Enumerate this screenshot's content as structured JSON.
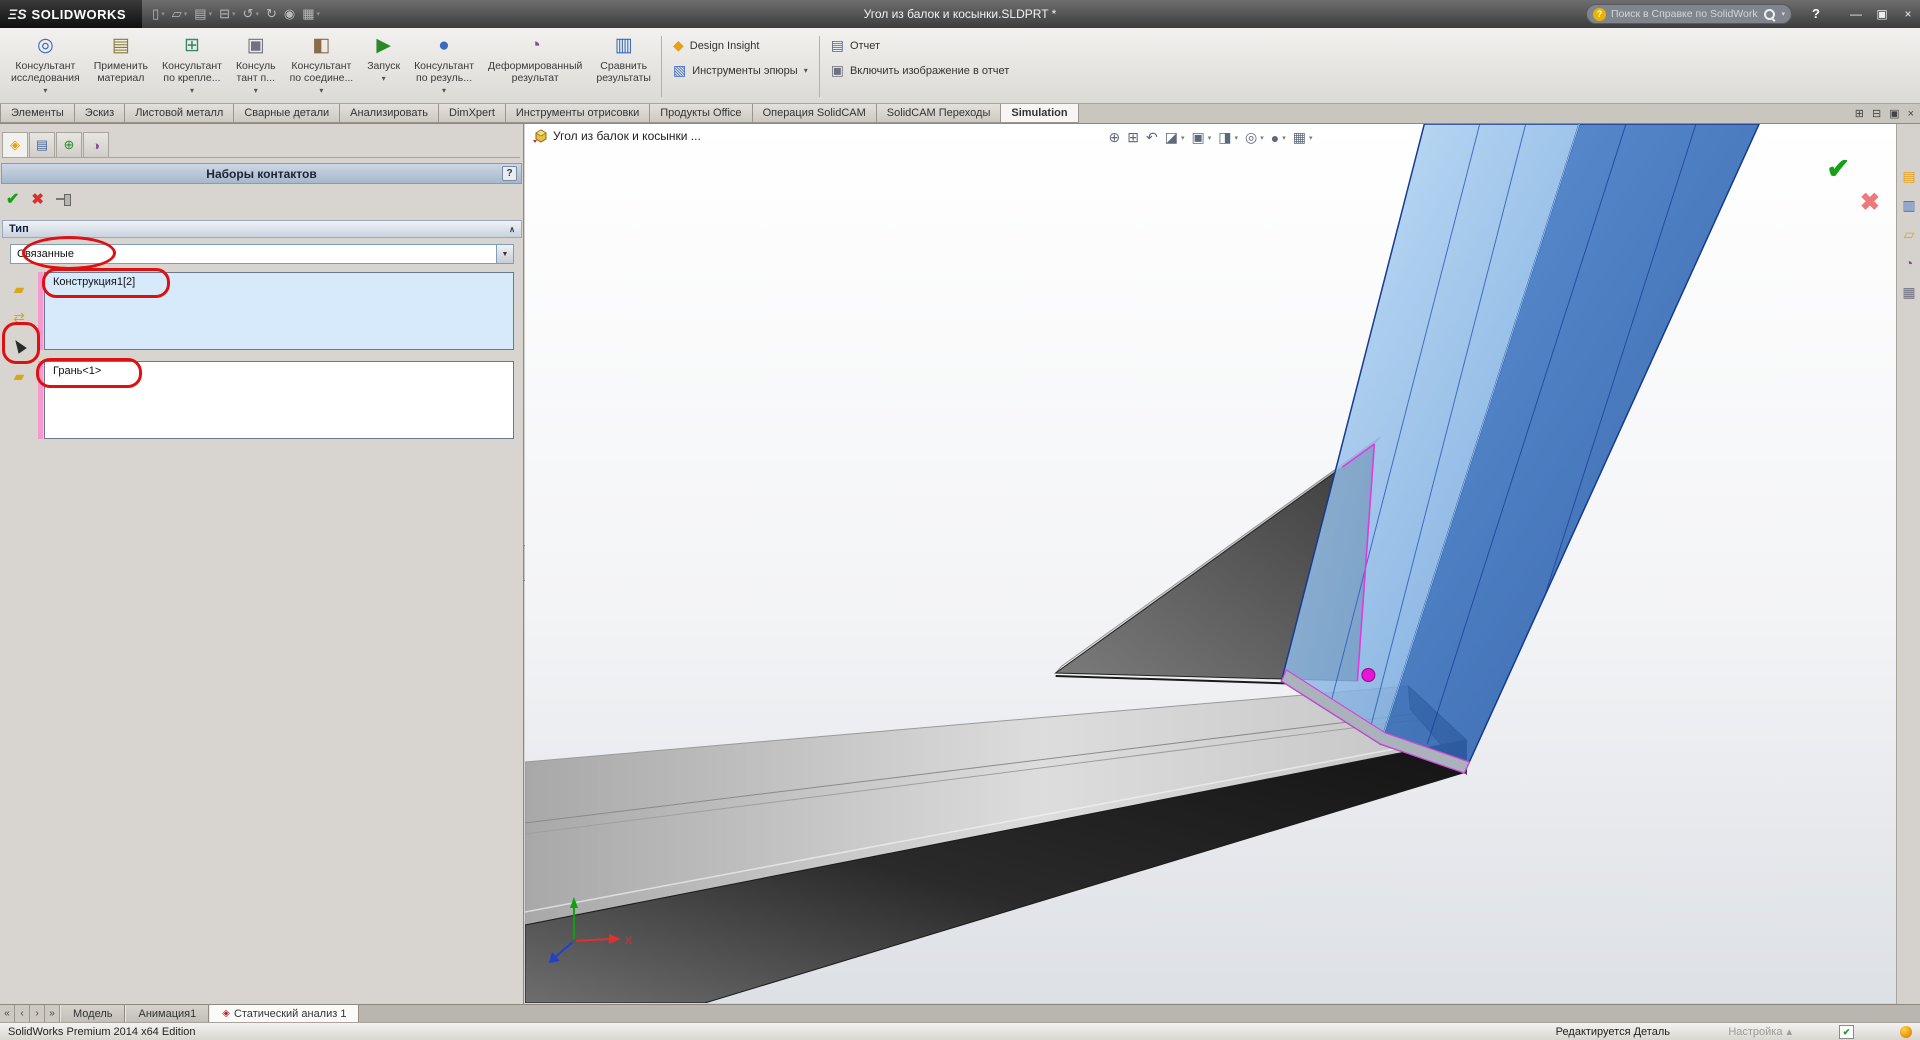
{
  "title_bar": {
    "logo_mark": "ΞS",
    "logo_text": "SOLIDWORKS",
    "document_title": "Угол из балок и косынки.SLDPRT *",
    "search_placeholder": "Поиск в Справке по SolidWorks"
  },
  "ribbon": {
    "buttons": [
      {
        "l1": "Консультант",
        "l2": "исследования"
      },
      {
        "l1": "Применить",
        "l2": "материал"
      },
      {
        "l1": "Консультант",
        "l2": "по крепле..."
      },
      {
        "l1": "Консуль",
        "l2": "тант п..."
      },
      {
        "l1": "Консультант",
        "l2": "по соедине..."
      },
      {
        "l1": "Запуск",
        "l2": ""
      },
      {
        "l1": "Консультант",
        "l2": "по резуль..."
      },
      {
        "l1": "Деформированный",
        "l2": "результат"
      },
      {
        "l1": "Сравнить",
        "l2": "результаты"
      }
    ],
    "design_insight": "Design Insight",
    "plot_tools": "Инструменты эпюры",
    "report": "Отчет",
    "include_image": "Включить изображение в отчет"
  },
  "command_tabs": [
    "Элементы",
    "Эскиз",
    "Листовой металл",
    "Сварные детали",
    "Анализировать",
    "DimXpert",
    "Инструменты отрисовки",
    "Продукты Office",
    "Операция SolidCAM",
    "SolidCAM Переходы",
    "Simulation"
  ],
  "panel": {
    "header": "Наборы контактов",
    "help": "?",
    "group_type": "Тип",
    "dropdown_value": "Связанные",
    "list1_item": "Конструкция1[2]",
    "list2_item": "Грань<1>"
  },
  "viewport": {
    "doc_label": "Угол из балок и косынки ...",
    "triad_x": "X"
  },
  "bottom_tabs": [
    "Модель",
    "Анимация1",
    "Статический анализ 1"
  ],
  "status_bar": {
    "left": "SolidWorks Premium 2014 x64 Edition",
    "editing": "Редактируется Деталь",
    "settings": "Настройка"
  },
  "icons": {
    "dropdown_arrow": "▾",
    "combo_arrow": "▼",
    "collapse_chevron": "∧",
    "up_arrow": "▴",
    "ok_check": "✔",
    "cancel_cross": "✖",
    "splitter_arrow": "◂",
    "qat": {
      "new": "▯",
      "open": "▱",
      "save": "▤",
      "print": "⊟",
      "undo": "↺",
      "redo": "↻",
      "rebuild": "◉",
      "options": "▦"
    },
    "ribbon_glyphs": [
      "◎",
      "▤",
      "⊞",
      "▣",
      "◧",
      "▶",
      "●",
      "◔",
      "▥"
    ],
    "stack_glyphs": {
      "design_insight": "◆",
      "plot_tools": "▧",
      "report": "▤",
      "include_image": "▣"
    },
    "pmp_tabs": [
      "◈",
      "▤",
      "⊕",
      "◑"
    ],
    "sel_icons": {
      "beam": "▰",
      "swap": "⇄",
      "face": "▰"
    },
    "viewport_bar": [
      "⊕",
      "⊞",
      "↶",
      "◪",
      "▣",
      "◨",
      "◎",
      "●",
      "▦"
    ],
    "doc_window": [
      "⊞",
      "⊟",
      "▣",
      "×"
    ],
    "nav": [
      "«",
      "‹",
      "›",
      "»"
    ],
    "right_bar": [
      "▤",
      "▥",
      "▱",
      "◔",
      "▦"
    ],
    "study_tab_glyph": "◈"
  },
  "colors": {
    "annotation_red": "#dd1111",
    "selection_blue": "#4a86d8",
    "magenta_highlight": "#e020d8",
    "pink_strip": "#f799cf",
    "ok_green": "#16a016",
    "cancel_red": "#d83030"
  }
}
